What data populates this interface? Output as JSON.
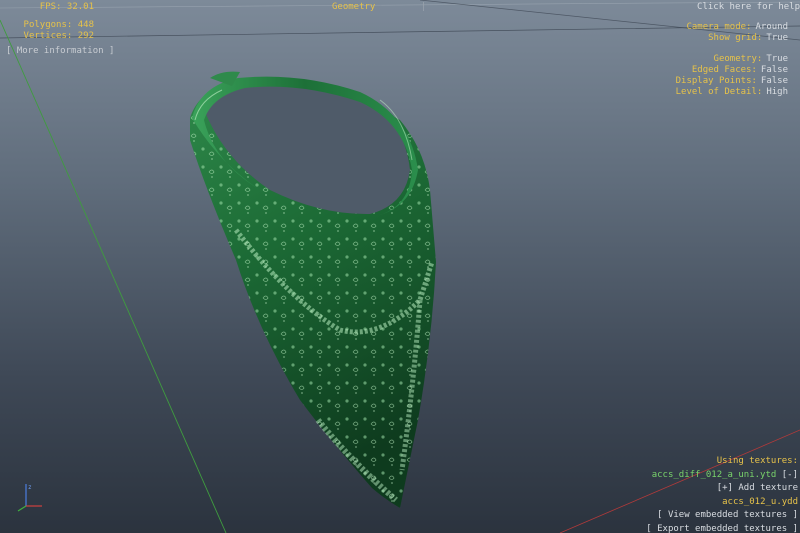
{
  "stats": {
    "fps_label": "FPS:",
    "fps_value": "32.01",
    "polygons_label": "Polygons:",
    "polygons_value": "448",
    "vertices_label": "Vertices:",
    "vertices_value": "292",
    "more_info": "[ More information ]"
  },
  "top_center": {
    "geometry_tab": "Geometry",
    "separator": "|"
  },
  "help": {
    "label": "Click here for help"
  },
  "settings": {
    "camera_mode_label": "Camera mode:",
    "camera_mode_value": "Around",
    "show_grid_label": "Show grid:",
    "show_grid_value": "True",
    "geometry_label": "Geometry:",
    "geometry_value": "True",
    "edged_faces_label": "Edged Faces:",
    "edged_faces_value": "False",
    "display_points_label": "Display Points:",
    "display_points_value": "False",
    "lod_label": "Level of Detail:",
    "lod_value": "High"
  },
  "textures": {
    "heading": "Using textures:",
    "texture_file": "accs_diff_012_a_uni.ytd",
    "remove": "[-]",
    "add": "[+] Add texture",
    "model_file": "accs_012_u.ydd",
    "view_embedded": "[ View embedded textures ]",
    "export_embedded": "[ Export embedded textures ]"
  },
  "colors": {
    "accent_yellow": "#e6c24a",
    "file_green": "#79d36b",
    "bandana_green": "#1f6b36"
  }
}
